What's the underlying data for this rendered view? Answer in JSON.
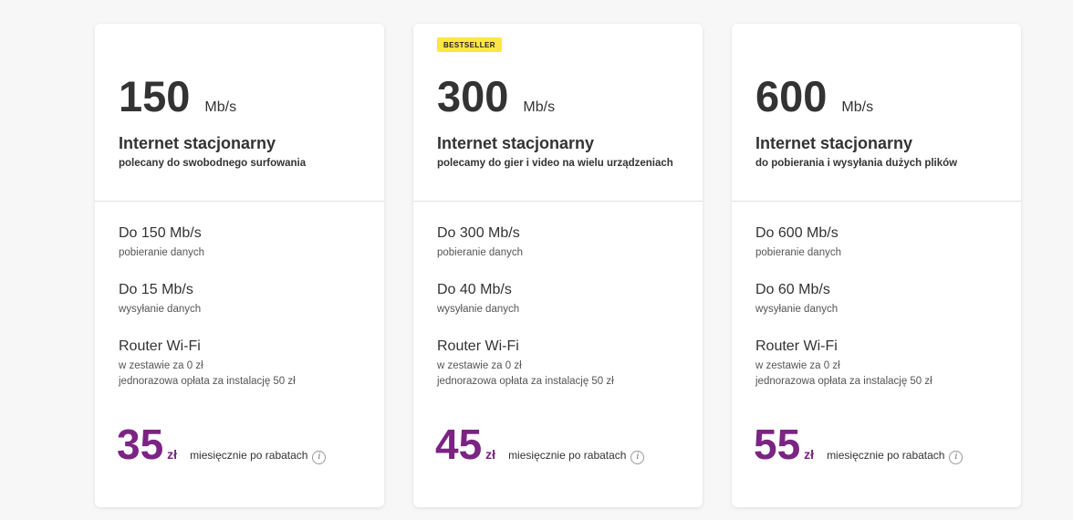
{
  "plans": [
    {
      "badge": "",
      "speed": "150",
      "speed_unit": "Mb/s",
      "title": "Internet stacjonarny",
      "subtitle": "polecany do swobodnego surfowania",
      "features": [
        {
          "label": "Do 150 Mb/s",
          "sub": "pobieranie danych"
        },
        {
          "label": "Do 15 Mb/s",
          "sub": "wysyłanie danych"
        },
        {
          "label": "Router Wi-Fi",
          "sub": "w zestawie za 0 zł",
          "sub2": "jednorazowa opłata za instalację 50 zł"
        }
      ],
      "price": "35",
      "currency": "zł",
      "price_note": "miesięcznie po rabatach",
      "info_icon": "i"
    },
    {
      "badge": "BESTSELLER",
      "speed": "300",
      "speed_unit": "Mb/s",
      "title": "Internet stacjonarny",
      "subtitle": "polecamy do gier i video na wielu urządzeniach",
      "features": [
        {
          "label": "Do 300 Mb/s",
          "sub": "pobieranie danych"
        },
        {
          "label": "Do 40 Mb/s",
          "sub": "wysyłanie danych"
        },
        {
          "label": "Router Wi-Fi",
          "sub": "w zestawie za 0 zł",
          "sub2": "jednorazowa opłata za instalację 50 zł"
        }
      ],
      "price": "45",
      "currency": "zł",
      "price_note": "miesięcznie po rabatach",
      "info_icon": "i"
    },
    {
      "badge": "",
      "speed": "600",
      "speed_unit": "Mb/s",
      "title": "Internet stacjonarny",
      "subtitle": "do pobierania i wysyłania dużych plików",
      "features": [
        {
          "label": "Do 600 Mb/s",
          "sub": "pobieranie danych"
        },
        {
          "label": "Do 60 Mb/s",
          "sub": "wysyłanie danych"
        },
        {
          "label": "Router Wi-Fi",
          "sub": "w zestawie za 0 zł",
          "sub2": "jednorazowa opłata za instalację 50 zł"
        }
      ],
      "price": "55",
      "currency": "zł",
      "price_note": "miesięcznie po rabatach",
      "info_icon": "i"
    }
  ],
  "colors": {
    "price_accent": "#7b2483",
    "badge_bg": "#ffe642",
    "text": "#333333"
  }
}
